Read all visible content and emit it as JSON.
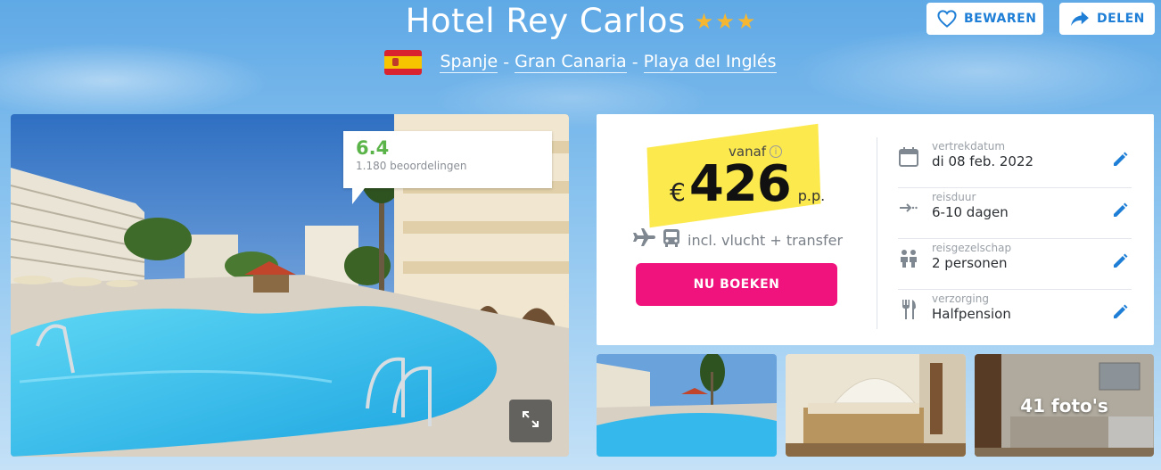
{
  "header": {
    "title": "Hotel Rey Carlos",
    "star_count": 3,
    "flag_icon": "spain-flag-icon",
    "location": [
      "Spanje",
      "Gran Canaria",
      "Playa del Inglés"
    ],
    "separator": "-"
  },
  "actions": {
    "save_label": "BEWAREN",
    "share_label": "DELEN"
  },
  "rating": {
    "score": "6.4",
    "reviews": "1.180 beoordelingen"
  },
  "booking": {
    "from_label": "vanaf",
    "currency": "€",
    "price": "426",
    "per_person": "p.p.",
    "includes": "incl. vlucht + transfer",
    "book_label": "NU BOEKEN",
    "details": [
      {
        "icon": "calendar-icon",
        "label": "vertrekdatum",
        "value": "di 08 feb. 2022"
      },
      {
        "icon": "duration-icon",
        "label": "reisduur",
        "value": "6-10 dagen"
      },
      {
        "icon": "people-icon",
        "label": "reisgezelschap",
        "value": "2 personen"
      },
      {
        "icon": "cutlery-icon",
        "label": "verzorging",
        "value": "Halfpension"
      }
    ]
  },
  "gallery": {
    "photo_count_label": "41 foto's"
  },
  "colors": {
    "accent": "#f0137d",
    "link": "#1f7fd6",
    "rating": "#5bb449",
    "star": "#f5b731",
    "highlight": "#fbe94d"
  }
}
